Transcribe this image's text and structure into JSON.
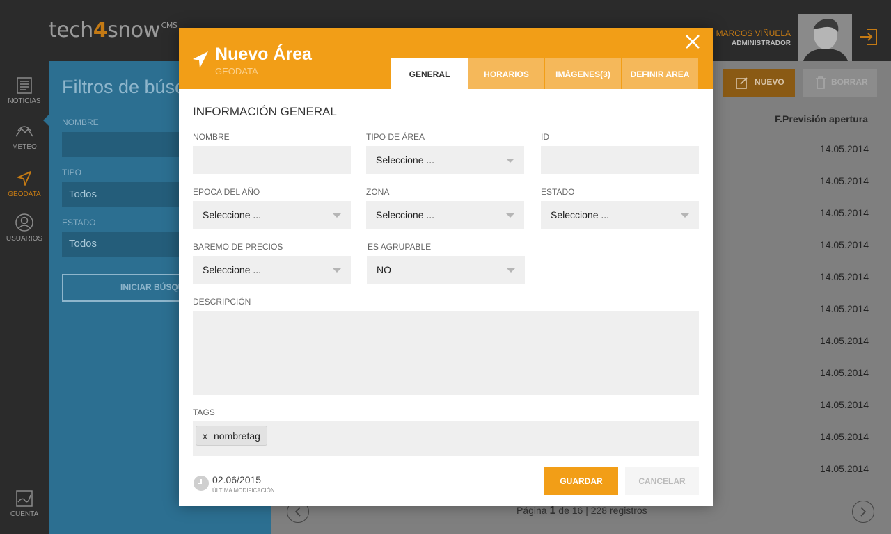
{
  "app": {
    "logo_left": "tech",
    "logo_four": "4",
    "logo_right": "snow",
    "logo_suffix": "CMS"
  },
  "user": {
    "name": "MARCOS VIÑUELA",
    "role": "ADMINISTRADOR"
  },
  "sidebar": {
    "items": [
      {
        "label": "NOTICIAS",
        "icon": "news-icon"
      },
      {
        "label": "METEO",
        "icon": "weather-icon"
      },
      {
        "label": "GEODATA",
        "icon": "location-arrow-icon",
        "active": true
      },
      {
        "label": "USUARIOS",
        "icon": "user-icon"
      }
    ],
    "bottom_label": "CUENTA"
  },
  "filters": {
    "title": "Filtros de búsqueda",
    "nombre_label": "NOMBRE",
    "tipo_label": "TIPO",
    "tipo_value": "Todos",
    "estado_label": "ESTADO",
    "estado_value": "Todos",
    "search_button": "INICIAR BÚSQUEDA"
  },
  "list": {
    "new_button": "NUEVO",
    "delete_button": "BORRAR",
    "column_header_partial": "o",
    "column_header": "F.Previsión apertura",
    "dates": [
      "14.05.2014",
      "14.05.2014",
      "14.05.2014",
      "14.05.2014",
      "14.05.2014",
      "14.05.2014",
      "14.05.2014",
      "14.05.2014",
      "14.05.2014",
      "14.05.2014",
      "14.05.2014"
    ],
    "pagination": {
      "prefix": "Página",
      "current": "1",
      "suffix": "de 16 | 228 registros"
    }
  },
  "modal": {
    "title": "Nuevo Área",
    "subtitle": "GEODATA",
    "tabs": [
      {
        "label": "GENERAL",
        "active": true
      },
      {
        "label": "HORARIOS"
      },
      {
        "label": "IMÁGENES(3)"
      },
      {
        "label": "DEFINIR AREA"
      }
    ],
    "section_title": "INFORMACIÓN GENERAL",
    "fields": {
      "nombre_label": "NOMBRE",
      "tipo_area_label": "TIPO DE ÁREA",
      "tipo_area_value": "Seleccione ...",
      "id_label": "ID",
      "epoca_label": "EPOCA DEL AÑO",
      "epoca_value": "Seleccione ...",
      "zona_label": "ZONA",
      "zona_value": "Seleccione ...",
      "estado_label": "ESTADO",
      "estado_value": "Seleccione ...",
      "baremo_label": "BAREMO DE PRECIOS",
      "baremo_value": "Seleccione ...",
      "agrupable_label": "ES AGRUPABLE",
      "agrupable_value": "NO",
      "descripcion_label": "DESCRIPCIÓN",
      "tags_label": "TAGS",
      "tags": [
        {
          "remove": "x",
          "text": "nombretag"
        }
      ]
    },
    "footer": {
      "date": "02.06/2015",
      "date_caption": "ÚLTIMA MODIFICACIÓN",
      "save_button": "GUARDAR",
      "cancel_button": "CANCELAR"
    }
  },
  "colors": {
    "accent": "#f29e17",
    "sidebar_bg": "#2b2b2b",
    "filters_bg": "#2c6f91"
  }
}
